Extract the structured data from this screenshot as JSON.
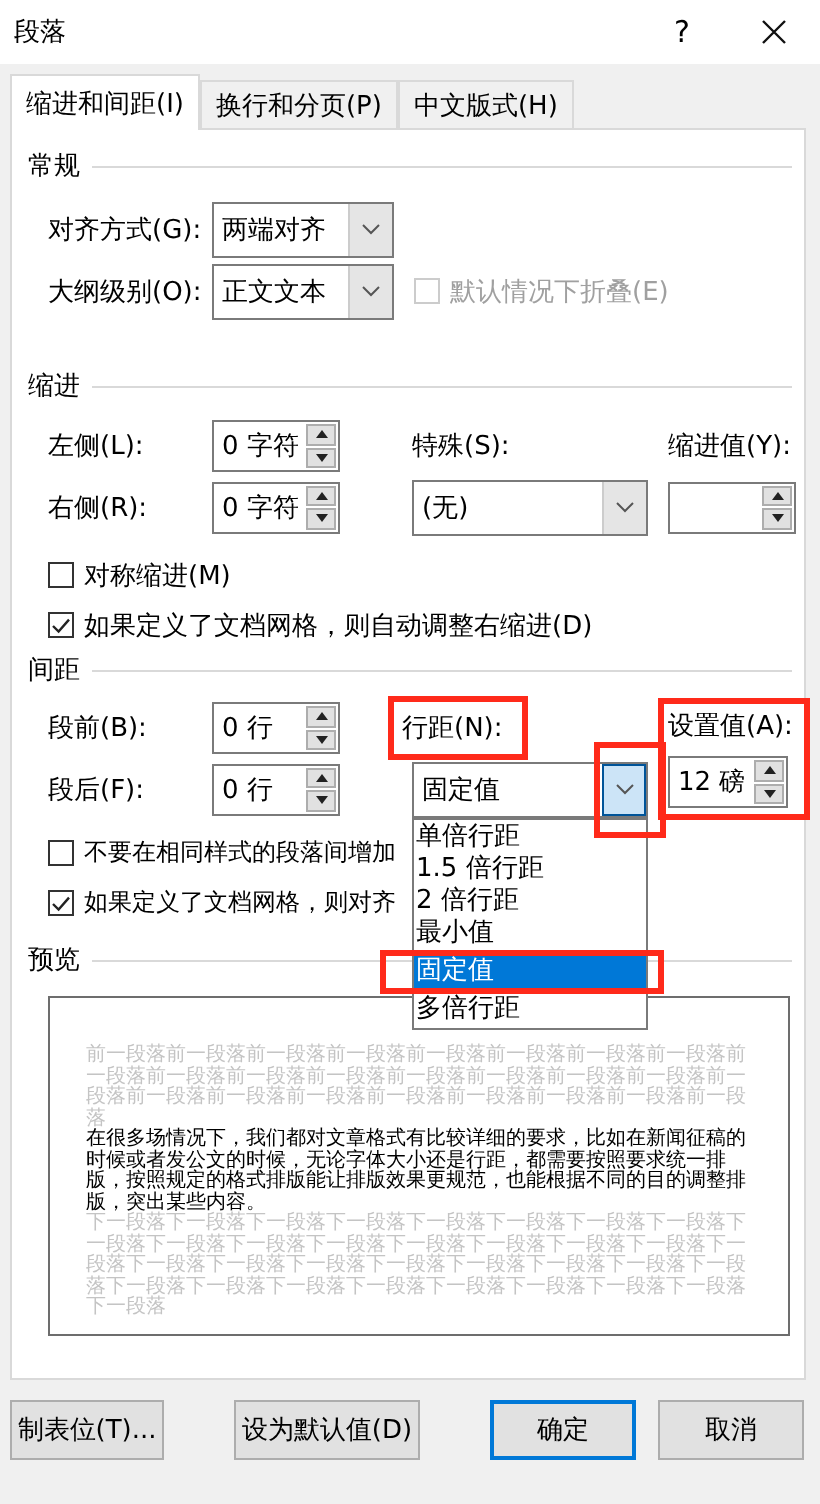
{
  "window": {
    "title": "段落",
    "help": "?"
  },
  "tabs": [
    {
      "label": "缩进和间距(I)",
      "selected": true
    },
    {
      "label": "换行和分页(P)",
      "selected": false
    },
    {
      "label": "中文版式(H)",
      "selected": false
    }
  ],
  "general": {
    "heading": "常规",
    "alignment": {
      "label": "对齐方式(G):",
      "value": "两端对齐"
    },
    "outline_level": {
      "label": "大纲级别(O):",
      "value": "正文文本"
    },
    "collapsed": {
      "label": "默认情况下折叠(E)",
      "checked": false,
      "disabled": true
    }
  },
  "indent": {
    "heading": "缩进",
    "left": {
      "label": "左侧(L):",
      "value": "0 字符"
    },
    "right": {
      "label": "右侧(R):",
      "value": "0 字符"
    },
    "special": {
      "label": "特殊(S):",
      "value": "(无)"
    },
    "by": {
      "label": "缩进值(Y):"
    },
    "mirror": {
      "label": "对称缩进(M)",
      "checked": false
    },
    "auto_adjust": {
      "label": "如果定义了文档网格，则自动调整右缩进(D)",
      "checked": true
    }
  },
  "spacing": {
    "heading": "间距",
    "before": {
      "label": "段前(B):",
      "value": "0 行"
    },
    "after": {
      "label": "段后(F):",
      "value": "0 行"
    },
    "line_spacing": {
      "label": "行距(N):",
      "value": "固定值",
      "highlighted": true,
      "expanded": true,
      "button_highlighted": true,
      "options": [
        {
          "label": "单倍行距",
          "selected": false,
          "highlighted": false
        },
        {
          "label": "1.5 倍行距",
          "selected": false,
          "highlighted": false
        },
        {
          "label": "2 倍行距",
          "selected": false,
          "highlighted": false
        },
        {
          "label": "最小值",
          "selected": false,
          "highlighted": false
        },
        {
          "label": "固定值",
          "selected": true,
          "highlighted": true
        },
        {
          "label": "多倍行距",
          "selected": false,
          "highlighted": false
        }
      ]
    },
    "at": {
      "label": "设置值(A):",
      "value": "12 磅",
      "highlighted": true
    },
    "no_space": {
      "label": "不要在相同样式的段落间增加",
      "checked": false
    },
    "snap": {
      "label": "如果定义了文档网格，则对齐",
      "checked": true
    }
  },
  "preview": {
    "heading": "预览",
    "previous_paragraph": "前一段落前一段落前一段落前一段落前一段落前一段落前一段落前一段落前一段落前一段落前一段落前一段落前一段落前一段落前一段落前一段落前一段落前一段落前一段落前一段落前一段落前一段落前一段落前一段落前一段落",
    "sample_paragraph": "在很多场情况下，我们都对文章格式有比较详细的要求，比如在新闻征稿的时候或者发公文的时候，无论字体大小还是行距，都需要按照要求统一排版，按照规定的格式排版能让排版效果更规范，也能根据不同的目的调整排版，突出某些内容。",
    "next_paragraph": "下一段落下一段落下一段落下一段落下一段落下一段落下一段落下一段落下一段落下一段落下一段落下一段落下一段落下一段落下一段落下一段落下一段落下一段落下一段落下一段落下一段落下一段落下一段落下一段落下一段落下一段落下一段落下一段落下一段落下一段落下一段落下一段落下一段落下一段落"
  },
  "buttons": [
    {
      "label": "制表位(T)...",
      "kind": "normal"
    },
    {
      "label": "设为默认值(D)",
      "kind": "normal"
    },
    {
      "label": "确定",
      "kind": "default"
    },
    {
      "label": "取消",
      "kind": "normal"
    }
  ]
}
